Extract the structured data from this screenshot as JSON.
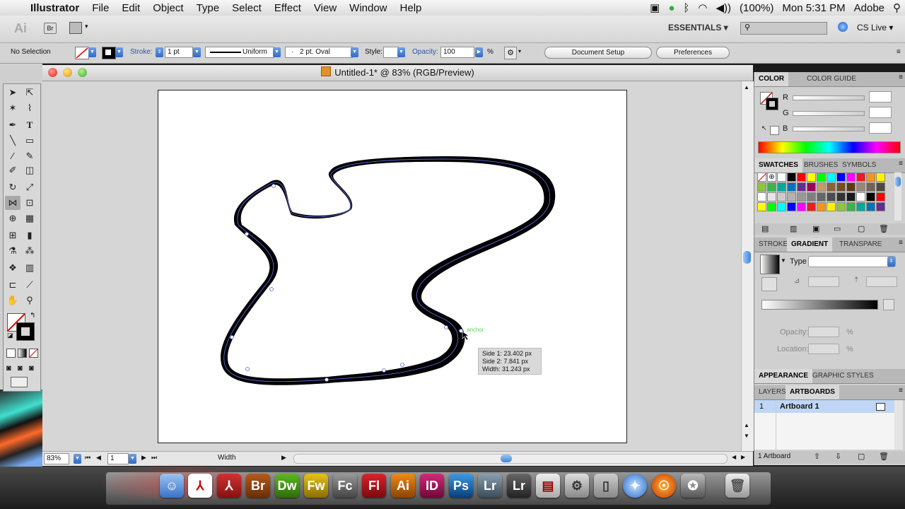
{
  "menubar": {
    "app_name": "Illustrator",
    "items": [
      "File",
      "Edit",
      "Object",
      "Type",
      "Select",
      "Effect",
      "View",
      "Window",
      "Help"
    ],
    "battery": "(100%)",
    "clock": "Mon 5:31 PM",
    "user": "Adobe"
  },
  "appbar": {
    "logo": "Ai",
    "bridge": "Br",
    "workspace": "ESSENTIALS ▾",
    "cslive": "CS Live ▾"
  },
  "control": {
    "selection": "No Selection",
    "stroke_label": "Stroke:",
    "stroke_weight": "1 pt",
    "profile": "Uniform",
    "brush": "2 pt. Oval",
    "style_label": "Style:",
    "opacity_label": "Opacity:",
    "opacity_value": "100",
    "opacity_unit": "%",
    "doc_setup": "Document Setup",
    "preferences": "Preferences"
  },
  "document": {
    "title": "Untitled-1* @ 83% (RGB/Preview)",
    "zoom": "83%",
    "artboard_num": "1",
    "status_tool": "Width",
    "anchor_hint": "anchor"
  },
  "tooltip": {
    "side1": "Side 1: 23.402 px",
    "side2": "Side 2: 7.841 px",
    "width": "Width:  31.243 px"
  },
  "panels": {
    "color_tab": "COLOR",
    "color_guide_tab": "COLOR GUIDE",
    "r": "R",
    "g": "G",
    "b": "B",
    "swatches_tab": "SWATCHES",
    "brushes_tab": "BRUSHES",
    "symbols_tab": "SYMBOLS",
    "stroke_tab": "STROKE",
    "gradient_tab": "GRADIENT",
    "transparency_tab": "TRANSPARE",
    "type_label": "Type",
    "opacity_label": "Opacity:",
    "location_label": "Location:",
    "pct": "%",
    "appearance_tab": "APPEARANCE",
    "graphic_styles_tab": "GRAPHIC STYLES",
    "layers_tab": "LAYERS",
    "artboards_tab": "ARTBOARDS",
    "artboard_row_num": "1",
    "artboard_row_name": "Artboard 1",
    "artboard_count": "1 Artboard"
  },
  "swatch_colors": [
    "#ffffff",
    "#000000",
    "#ff0000",
    "#ffff00",
    "#00ff00",
    "#00ffff",
    "#0000ff",
    "#ff00ff",
    "#ed1c24",
    "#f7941d",
    "#fff200",
    "#8dc63f",
    "#39b54a",
    "#00a99d",
    "#0072bc",
    "#662d91",
    "#9e005d",
    "#c69c6d",
    "#8c6239",
    "#754c24",
    "#603913",
    "#998675",
    "#736357",
    "#534741",
    "#ffffff",
    "#e6e6e6",
    "#cccccc",
    "#b3b3b3",
    "#999999",
    "#808080",
    "#666666",
    "#4d4d4d",
    "#333333",
    "#1a1a1a"
  ],
  "dock": [
    "Finder",
    "Acrobat",
    "Acrobat",
    "Br",
    "Dw",
    "Fw",
    "Fc",
    "Fl",
    "Ai",
    "ID",
    "Ps",
    "Lr",
    "Lr",
    "PDF",
    "Flash",
    "Preview",
    "Safari",
    "Firefox",
    "Photo",
    "Trash"
  ],
  "dock_labels": {
    "br": "Br",
    "dw": "Dw",
    "fw": "Fw",
    "fc": "Fc",
    "fl": "Fl",
    "ai": "Ai",
    "id": "ID",
    "ps": "Ps",
    "lr": "Lr",
    "lr2": "Lr"
  }
}
